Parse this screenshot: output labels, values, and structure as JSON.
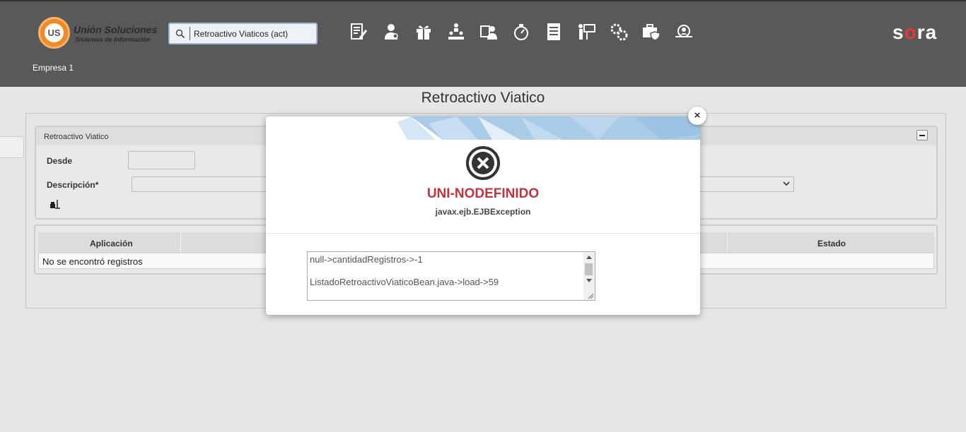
{
  "header": {
    "logo_mark": "US",
    "logo_name": "Unión Soluciones",
    "logo_tagline": "Sistemas de Información",
    "search_value": "Retroactivo Viaticos (act)",
    "brand": {
      "pre": "s",
      "accent": "o",
      "post": "ra"
    },
    "empresa": "Empresa 1",
    "nav_icons": [
      "document-edit-icon",
      "person-icon",
      "gift-icon",
      "org-hierarchy-icon",
      "person-card-icon",
      "stopwatch-icon",
      "report-icon",
      "presentation-icon",
      "gears-icon",
      "medical-kit-icon",
      "person-search-icon"
    ]
  },
  "page": {
    "title": "Retroactivo Viatico",
    "panel_title": "Retroactivo Viatico",
    "desde_label": "Desde",
    "descripcion_label": "Descripción*"
  },
  "table": {
    "columns": [
      "Aplicación",
      "Estado"
    ],
    "empty_message": "No se encontró registros"
  },
  "modal": {
    "title": "UNI-NODEFINIDO",
    "subtitle": "javax.ejb.EJBException",
    "lines": [
      "null->cantidadRegistros->-1",
      "ListadoRetroactivoViaticoBean.java->load->59"
    ],
    "close": "×"
  },
  "colors": {
    "header_bg": "#595959",
    "error_red": "#c0343f",
    "brand_accent": "#e53935",
    "search_border": "#9db7d6"
  }
}
